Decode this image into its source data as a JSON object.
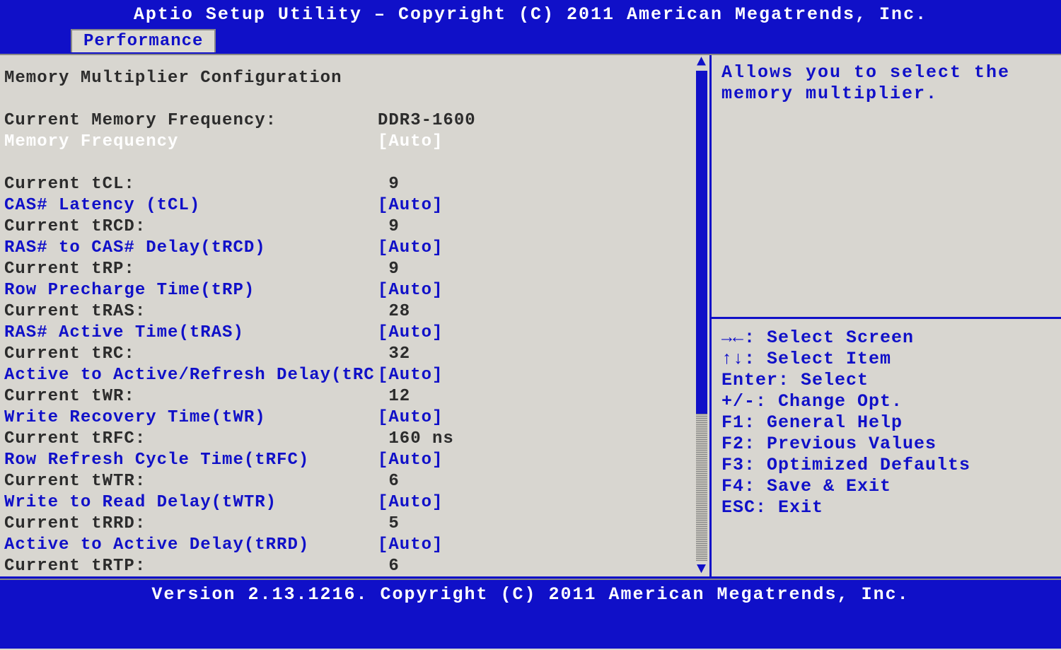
{
  "header": {
    "title": "Aptio Setup Utility – Copyright (C) 2011 American Megatrends, Inc.",
    "tab": "Performance"
  },
  "section_title": "Memory Multiplier Configuration",
  "rows": [
    {
      "type": "static",
      "label": "Current Memory Frequency:",
      "value": "DDR3-1600"
    },
    {
      "type": "selected",
      "label": "Memory Frequency",
      "value": "[Auto]"
    },
    {
      "type": "spacer"
    },
    {
      "type": "static",
      "label": "Current tCL:",
      "value": " 9"
    },
    {
      "type": "setting",
      "label": "CAS# Latency (tCL)",
      "value": "[Auto]"
    },
    {
      "type": "static",
      "label": "Current tRCD:",
      "value": " 9"
    },
    {
      "type": "setting",
      "label": "RAS# to CAS# Delay(tRCD)",
      "value": "[Auto]"
    },
    {
      "type": "static",
      "label": "Current tRP:",
      "value": " 9"
    },
    {
      "type": "setting",
      "label": "Row Precharge Time(tRP)",
      "value": "[Auto]"
    },
    {
      "type": "static",
      "label": "Current tRAS:",
      "value": " 28"
    },
    {
      "type": "setting",
      "label": "RAS# Active Time(tRAS)",
      "value": "[Auto]"
    },
    {
      "type": "static",
      "label": "Current tRC:",
      "value": " 32"
    },
    {
      "type": "setting",
      "label": "Active to Active/Refresh Delay(tRC",
      "value": "[Auto]"
    },
    {
      "type": "static",
      "label": "Current tWR:",
      "value": " 12"
    },
    {
      "type": "setting",
      "label": "Write Recovery Time(tWR)",
      "value": "[Auto]"
    },
    {
      "type": "static",
      "label": "Current tRFC:",
      "value": " 160 ns"
    },
    {
      "type": "setting",
      "label": "Row Refresh Cycle Time(tRFC)",
      "value": "[Auto]"
    },
    {
      "type": "static",
      "label": "Current tWTR:",
      "value": " 6"
    },
    {
      "type": "setting",
      "label": "Write to Read Delay(tWTR)",
      "value": "[Auto]"
    },
    {
      "type": "static",
      "label": "Current tRRD:",
      "value": " 5"
    },
    {
      "type": "setting",
      "label": "Active to Active Delay(tRRD)",
      "value": "[Auto]"
    },
    {
      "type": "static",
      "label": "Current tRTP:",
      "value": " 6"
    }
  ],
  "help": {
    "text": "Allows you to select the memory multiplier."
  },
  "nav": [
    "→←: Select Screen",
    "↑↓: Select Item",
    "Enter: Select",
    "+/-: Change Opt.",
    "F1: General Help",
    "F2: Previous Values",
    "F3: Optimized Defaults",
    "F4: Save & Exit",
    "ESC: Exit"
  ],
  "footer": "Version 2.13.1216. Copyright (C) 2011 American Megatrends, Inc."
}
